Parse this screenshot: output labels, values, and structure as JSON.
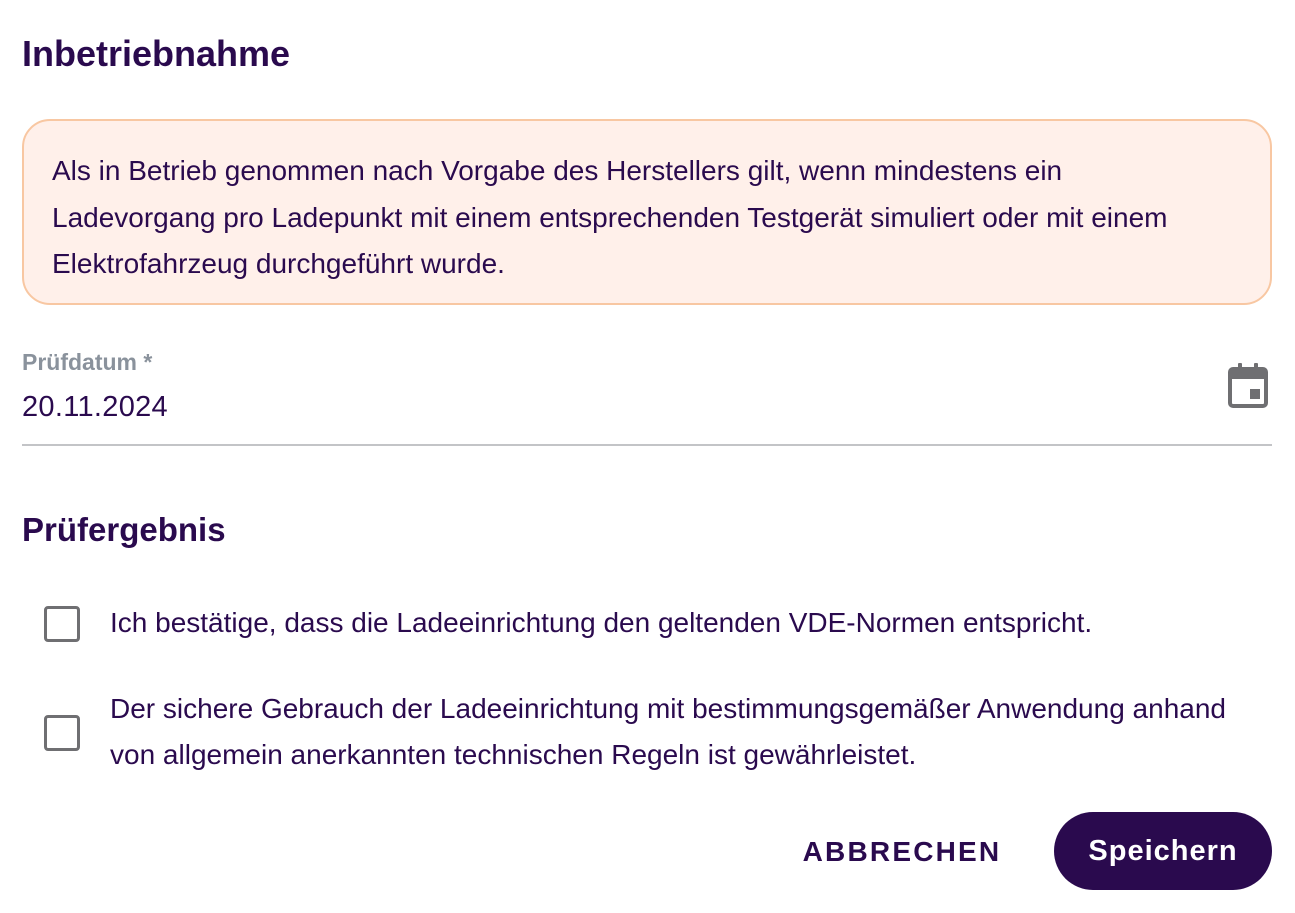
{
  "dialog": {
    "title": "Inbetriebnahme",
    "notice": "Als in Betrieb genommen nach Vorgabe des Herstellers gilt, wenn mindestens ein Ladevorgang pro Ladepunkt mit einem entsprechenden Testgerät simuliert oder mit einem Elektrofahrzeug durchgeführt wurde.",
    "date_field": {
      "label": "Prüfdatum *",
      "value": "20.11.2024",
      "icon": "calendar-icon"
    },
    "result": {
      "title": "Prüfergebnis",
      "checks": [
        {
          "label": "Ich bestätige, dass die Ladeeinrichtung den geltenden VDE-Normen entspricht.",
          "checked": false
        },
        {
          "label": "Der sichere Gebrauch der Ladeeinrichtung mit bestimmungsgemäßer Anwendung anhand von allgemein anerkannten technischen Regeln ist gewährleistet.",
          "checked": false
        }
      ]
    },
    "actions": {
      "cancel_label": "ABBRECHEN",
      "save_label": "Speichern"
    }
  },
  "colors": {
    "primary": "#2a0a4e",
    "notice_background": "#fff0ea",
    "notice_border": "#f8c7a2",
    "label_gray": "#8a929c",
    "divider": "#c3c4c7"
  }
}
